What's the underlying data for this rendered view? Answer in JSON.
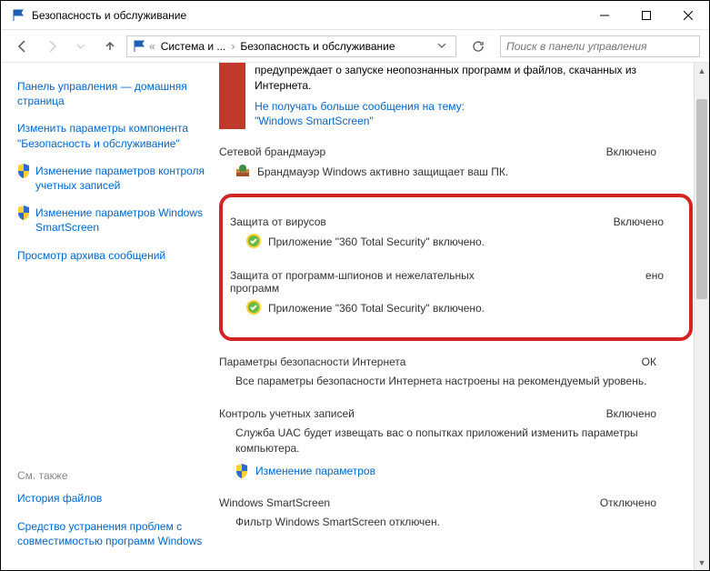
{
  "titlebar": {
    "title": "Безопасность и обслуживание"
  },
  "nav": {
    "bc_first": "Система и ...",
    "bc_second": "Безопасность и обслуживание",
    "search_placeholder": "Поиск в панели управления"
  },
  "sidebar": {
    "link_home": "Панель управления — домашняя страница",
    "link_params": "Изменить параметры компонента \"Безопасность и обслуживание\"",
    "link_uac": "Изменение параметров контроля учетных записей",
    "link_smartscreen": "Изменение параметров Windows SmartScreen",
    "link_archive": "Просмотр архива сообщений",
    "see_also": "См. также",
    "link_history": "История файлов",
    "link_troubleshoot": "Средство устранения проблем с совместимостью программ Windows"
  },
  "notice": {
    "line1": "предупреждает о запуске неопознанных программ и файлов, скачанных из Интернета.",
    "link1": "Не получать больше сообщения на тему:",
    "link2": "\"Windows SmartScreen\""
  },
  "sections": {
    "firewall": {
      "label": "Сетевой брандмауэр",
      "status": "Включено",
      "sub": "Брандмауэр Windows активно защищает ваш ПК."
    },
    "virus": {
      "label": "Защита от вирусов",
      "status": "Включено",
      "sub": "Приложение \"360 Total Security\" включено."
    },
    "spyware": {
      "label": "Защита от программ-шпионов и нежелательных программ",
      "status": "ено",
      "sub": "Приложение \"360 Total Security\" включено."
    },
    "inet": {
      "label": "Параметры безопасности Интернета",
      "status": "ОК",
      "sub": "Все параметры безопасности Интернета настроены на рекомендуемый уровень."
    },
    "uac": {
      "label": "Контроль учетных записей",
      "status": "Включено",
      "sub": "Служба UAC будет извещать вас о попытках приложений изменить параметры компьютера.",
      "link": "Изменение параметров"
    },
    "ss": {
      "label": "Windows SmartScreen",
      "status": "Отключено",
      "sub": "Фильтр Windows SmartScreen отключен."
    }
  }
}
